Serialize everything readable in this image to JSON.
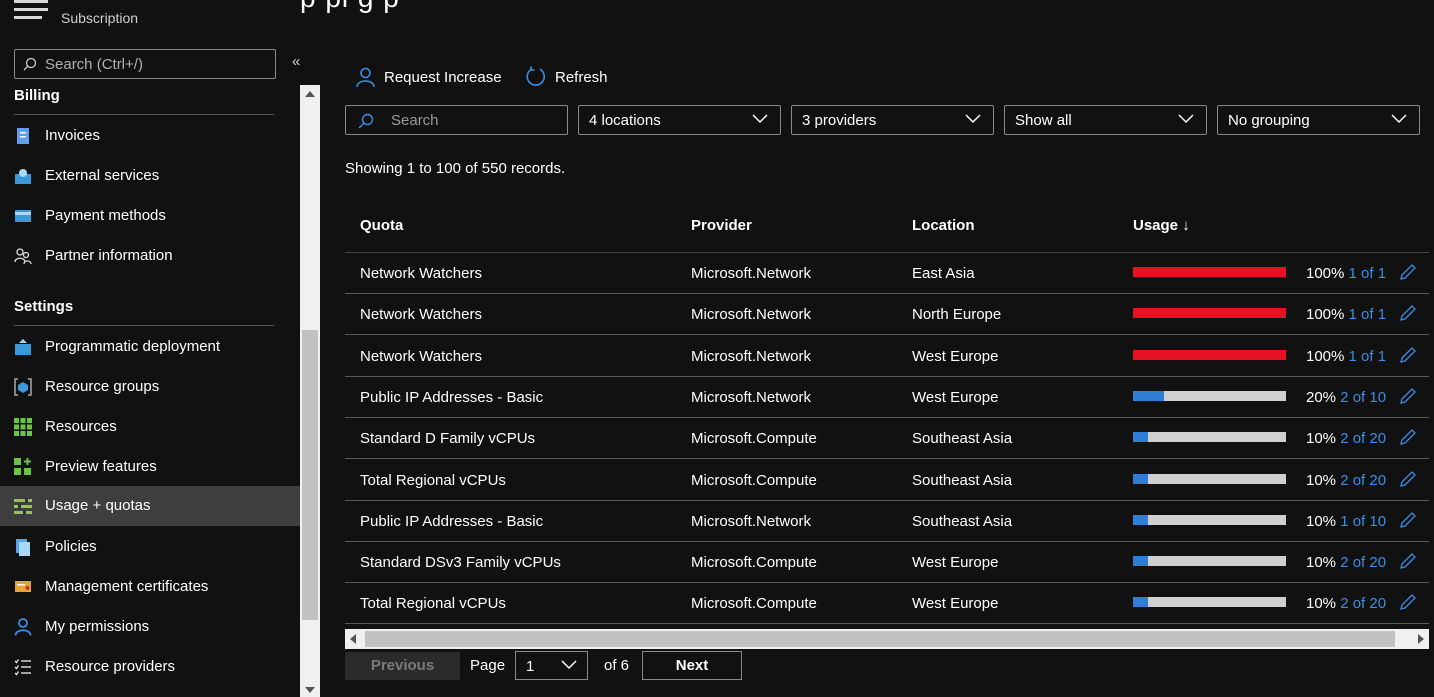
{
  "header": {
    "subtitle": "Subscription",
    "title_fragment": "p  pi g  p"
  },
  "sidebar": {
    "search_placeholder": "Search (Ctrl+/)",
    "collapse_label": "«",
    "sections": [
      {
        "title": "Billing",
        "items": [
          {
            "label": "Invoices",
            "icon": "invoice-icon"
          },
          {
            "label": "External services",
            "icon": "external-services-icon"
          },
          {
            "label": "Payment methods",
            "icon": "payment-card-icon"
          },
          {
            "label": "Partner information",
            "icon": "partner-people-icon"
          }
        ]
      },
      {
        "title": "Settings",
        "items": [
          {
            "label": "Programmatic deployment",
            "icon": "deployment-icon"
          },
          {
            "label": "Resource groups",
            "icon": "resource-group-icon"
          },
          {
            "label": "Resources",
            "icon": "grid-icon"
          },
          {
            "label": "Preview features",
            "icon": "preview-icon"
          },
          {
            "label": "Usage + quotas",
            "icon": "usage-quotas-icon",
            "selected": true
          },
          {
            "label": "Policies",
            "icon": "policy-icon"
          },
          {
            "label": "Management certificates",
            "icon": "certificate-icon"
          },
          {
            "label": "My permissions",
            "icon": "person-icon"
          },
          {
            "label": "Resource providers",
            "icon": "list-icon"
          }
        ]
      }
    ]
  },
  "toolbar": {
    "request_increase": "Request Increase",
    "refresh": "Refresh"
  },
  "filters": {
    "search_placeholder": "Search",
    "locations": "4 locations",
    "providers": "3 providers",
    "show": "Show all",
    "grouping": "No grouping"
  },
  "records_text": "Showing 1 to 100 of 550 records.",
  "table": {
    "columns": [
      "Quota",
      "Provider",
      "Location",
      "Usage ↓"
    ],
    "rows": [
      {
        "quota": "Network Watchers",
        "provider": "Microsoft.Network",
        "location": "East Asia",
        "usage_pct": 100,
        "pct_label": "100%",
        "of_label": "1 of 1",
        "bar_color": "#e81123"
      },
      {
        "quota": "Network Watchers",
        "provider": "Microsoft.Network",
        "location": "North Europe",
        "usage_pct": 100,
        "pct_label": "100%",
        "of_label": "1 of 1",
        "bar_color": "#e81123"
      },
      {
        "quota": "Network Watchers",
        "provider": "Microsoft.Network",
        "location": "West Europe",
        "usage_pct": 100,
        "pct_label": "100%",
        "of_label": "1 of 1",
        "bar_color": "#e81123"
      },
      {
        "quota": "Public IP Addresses - Basic",
        "provider": "Microsoft.Network",
        "location": "West Europe",
        "usage_pct": 20,
        "pct_label": "20%",
        "of_label": "2 of 10",
        "bar_color": "#2f7fd6"
      },
      {
        "quota": "Standard D Family vCPUs",
        "provider": "Microsoft.Compute",
        "location": "Southeast Asia",
        "usage_pct": 10,
        "pct_label": "10%",
        "of_label": "2 of 20",
        "bar_color": "#2f7fd6"
      },
      {
        "quota": "Total Regional vCPUs",
        "provider": "Microsoft.Compute",
        "location": "Southeast Asia",
        "usage_pct": 10,
        "pct_label": "10%",
        "of_label": "2 of 20",
        "bar_color": "#2f7fd6"
      },
      {
        "quota": "Public IP Addresses - Basic",
        "provider": "Microsoft.Network",
        "location": "Southeast Asia",
        "usage_pct": 10,
        "pct_label": "10%",
        "of_label": "1 of 10",
        "bar_color": "#2f7fd6"
      },
      {
        "quota": "Standard DSv3 Family vCPUs",
        "provider": "Microsoft.Compute",
        "location": "West Europe",
        "usage_pct": 10,
        "pct_label": "10%",
        "of_label": "2 of 20",
        "bar_color": "#2f7fd6"
      },
      {
        "quota": "Total Regional vCPUs",
        "provider": "Microsoft.Compute",
        "location": "West Europe",
        "usage_pct": 10,
        "pct_label": "10%",
        "of_label": "2 of 20",
        "bar_color": "#2f7fd6"
      }
    ]
  },
  "pager": {
    "previous": "Previous",
    "page_label": "Page",
    "current_page": "1",
    "of_label": "of 6",
    "next": "Next"
  }
}
